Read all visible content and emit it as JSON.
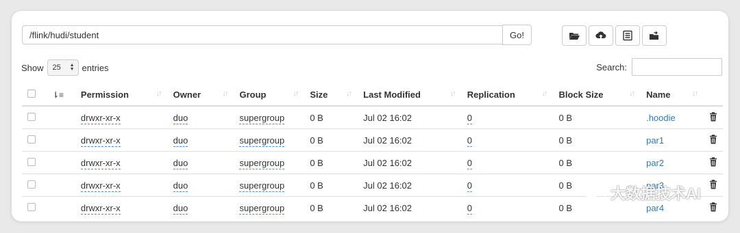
{
  "path": {
    "value": "/flink/hudi/student"
  },
  "go_label": "Go!",
  "toolbar": [
    "folder-open-icon",
    "upload-cloud-icon",
    "list-icon",
    "paste-icon"
  ],
  "show": {
    "prefix": "Show",
    "value": "25",
    "suffix": "entries"
  },
  "search": {
    "label": "Search:",
    "value": ""
  },
  "columns": [
    "Permission",
    "Owner",
    "Group",
    "Size",
    "Last Modified",
    "Replication",
    "Block Size",
    "Name"
  ],
  "rows": [
    {
      "permission": "drwxr-xr-x",
      "owner": "duo",
      "group": "supergroup",
      "size": "0 B",
      "modified": "Jul 02 16:02",
      "replication": "0",
      "block_size": "0 B",
      "name": ".hoodie"
    },
    {
      "permission": "drwxr-xr-x",
      "owner": "duo",
      "group": "supergroup",
      "size": "0 B",
      "modified": "Jul 02 16:02",
      "replication": "0",
      "block_size": "0 B",
      "name": "par1"
    },
    {
      "permission": "drwxr-xr-x",
      "owner": "duo",
      "group": "supergroup",
      "size": "0 B",
      "modified": "Jul 02 16:02",
      "replication": "0",
      "block_size": "0 B",
      "name": "par2"
    },
    {
      "permission": "drwxr-xr-x",
      "owner": "duo",
      "group": "supergroup",
      "size": "0 B",
      "modified": "Jul 02 16:02",
      "replication": "0",
      "block_size": "0 B",
      "name": "par3"
    },
    {
      "permission": "drwxr-xr-x",
      "owner": "duo",
      "group": "supergroup",
      "size": "0 B",
      "modified": "Jul 02 16:02",
      "replication": "0",
      "block_size": "0 B",
      "name": "par4"
    }
  ],
  "watermark": {
    "text": "大数据技术AI"
  },
  "colors": {
    "link": "#337ab7",
    "border": "#dddddd",
    "background": "#e9e9e9"
  }
}
